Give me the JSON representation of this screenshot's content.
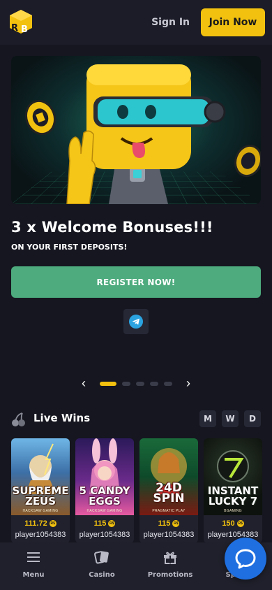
{
  "header": {
    "signin_label": "Sign In",
    "join_label": "Join Now"
  },
  "hero": {
    "title": "3 x Welcome Bonuses!!!",
    "subtitle": "ON YOUR FIRST DEPOSITS!",
    "register_label": "REGISTER NOW!",
    "slide_count": 5,
    "active_slide": 1
  },
  "live_wins": {
    "title": "Live Wins",
    "filters": [
      "M",
      "W",
      "D"
    ],
    "items": [
      {
        "game_line1": "SUPREME",
        "game_line2": "ZEUS",
        "provider": "HACKSAW GAMING",
        "amount": "111.72",
        "player": "player1054383"
      },
      {
        "game_line1": "5 CANDY",
        "game_line2": "EGGS",
        "provider": "HACKSAW GAMING",
        "amount": "115",
        "player": "player1054383"
      },
      {
        "game_line1": "24D SPIN",
        "game_line2": "",
        "provider": "PRAGMATIC PLAY",
        "amount": "115",
        "player": "player1054383"
      },
      {
        "game_line1": "INSTANT",
        "game_line2": "LUCKY 7",
        "provider": "BGAMING",
        "amount": "150",
        "player": "player1054383"
      }
    ],
    "currency_symbol": "R$"
  },
  "bottom_nav": {
    "items": [
      "Menu",
      "Casino",
      "Promotions",
      "Sports"
    ]
  },
  "colors": {
    "accent": "#f2c10f",
    "register": "#4dab7e",
    "chat": "#1f6fe0",
    "background": "#15161f"
  }
}
